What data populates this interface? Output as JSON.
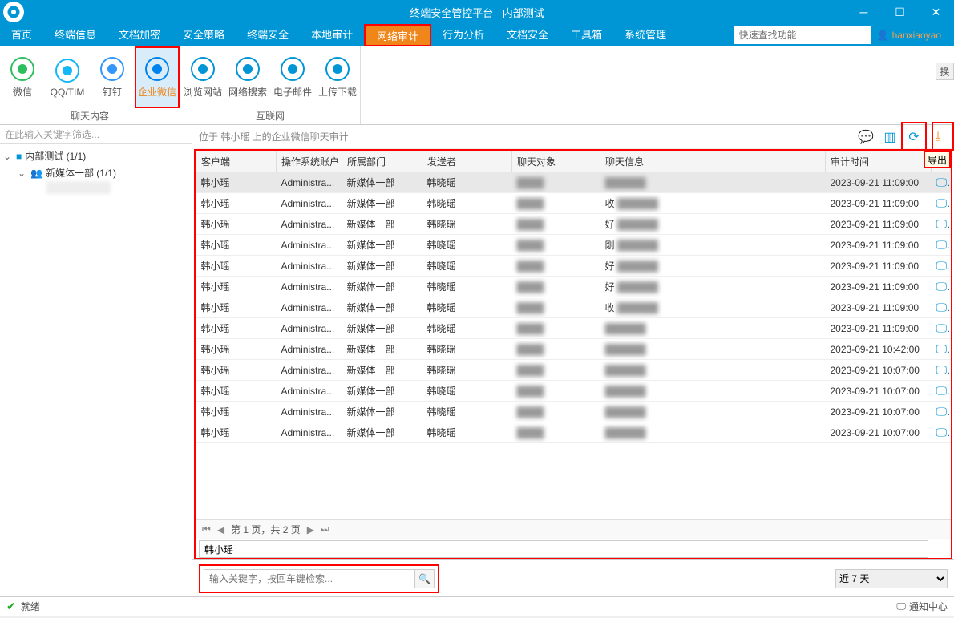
{
  "window": {
    "title": "终端安全管控平台 - 内部测试"
  },
  "menu": {
    "tabs": [
      "首页",
      "终端信息",
      "文档加密",
      "安全策略",
      "终端安全",
      "本地审计",
      "网络审计",
      "行为分析",
      "文档安全",
      "工具箱",
      "系统管理"
    ],
    "active": 6,
    "search_placeholder": "快速查找功能",
    "user": "hanxiaoyao"
  },
  "ribbon": {
    "group1_label": "聊天内容",
    "group2_label": "互联网",
    "buttons1": [
      {
        "label": "微信",
        "name": "wechat-icon"
      },
      {
        "label": "QQ/TIM",
        "name": "qq-icon"
      },
      {
        "label": "钉钉",
        "name": "dingtalk-icon"
      },
      {
        "label": "企业微信",
        "name": "wecom-icon",
        "active": true
      }
    ],
    "buttons2": [
      {
        "label": "浏览网站",
        "name": "browse-icon"
      },
      {
        "label": "网络搜索",
        "name": "search-icon"
      },
      {
        "label": "电子邮件",
        "name": "email-icon"
      },
      {
        "label": "上传下载",
        "name": "updown-icon"
      }
    ]
  },
  "sidebar": {
    "filter_placeholder": "在此输入关键字筛选...",
    "root": "内部测试 (1/1)",
    "child": "新媒体一部 (1/1)"
  },
  "main": {
    "breadcrumb": "位于 韩小瑶 上的企业微信聊天审计",
    "export_tooltip": "导出",
    "columns": [
      "客户端",
      "操作系统账户",
      "所属部门",
      "发送者",
      "聊天对象",
      "聊天信息",
      "审计时间",
      ""
    ],
    "rows": [
      {
        "c": "韩小瑶",
        "o": "Administra...",
        "d": "新媒体一部",
        "s": "韩晓瑶",
        "t": "",
        "m": "",
        "ts": "2023-09-21 11:09:00"
      },
      {
        "c": "韩小瑶",
        "o": "Administra...",
        "d": "新媒体一部",
        "s": "韩晓瑶",
        "t": "",
        "m": "收",
        "ts": "2023-09-21 11:09:00"
      },
      {
        "c": "韩小瑶",
        "o": "Administra...",
        "d": "新媒体一部",
        "s": "韩晓瑶",
        "t": "",
        "m": "好",
        "ts": "2023-09-21 11:09:00"
      },
      {
        "c": "韩小瑶",
        "o": "Administra...",
        "d": "新媒体一部",
        "s": "韩晓瑶",
        "t": "",
        "m": "刚",
        "ts": "2023-09-21 11:09:00"
      },
      {
        "c": "韩小瑶",
        "o": "Administra...",
        "d": "新媒体一部",
        "s": "韩晓瑶",
        "t": "",
        "m": "好",
        "ts": "2023-09-21 11:09:00"
      },
      {
        "c": "韩小瑶",
        "o": "Administra...",
        "d": "新媒体一部",
        "s": "韩晓瑶",
        "t": "",
        "m": "好",
        "ts": "2023-09-21 11:09:00"
      },
      {
        "c": "韩小瑶",
        "o": "Administra...",
        "d": "新媒体一部",
        "s": "韩晓瑶",
        "t": "",
        "m": "收",
        "ts": "2023-09-21 11:09:00"
      },
      {
        "c": "韩小瑶",
        "o": "Administra...",
        "d": "新媒体一部",
        "s": "韩晓瑶",
        "t": "",
        "m": "",
        "ts": "2023-09-21 11:09:00"
      },
      {
        "c": "韩小瑶",
        "o": "Administra...",
        "d": "新媒体一部",
        "s": "韩晓瑶",
        "t": "",
        "m": "",
        "ts": "2023-09-21 10:42:00"
      },
      {
        "c": "韩小瑶",
        "o": "Administra...",
        "d": "新媒体一部",
        "s": "韩晓瑶",
        "t": "",
        "m": "",
        "ts": "2023-09-21 10:07:00"
      },
      {
        "c": "韩小瑶",
        "o": "Administra...",
        "d": "新媒体一部",
        "s": "韩晓瑶",
        "t": "",
        "m": "",
        "ts": "2023-09-21 10:07:00"
      },
      {
        "c": "韩小瑶",
        "o": "Administra...",
        "d": "新媒体一部",
        "s": "韩晓瑶",
        "t": "",
        "m": "",
        "ts": "2023-09-21 10:07:00"
      },
      {
        "c": "韩小瑶",
        "o": "Administra...",
        "d": "新媒体一部",
        "s": "韩晓瑶",
        "t": "",
        "m": "",
        "ts": "2023-09-21 10:07:00"
      }
    ],
    "pager": "第 1 页，共 2 页",
    "detail_name": "韩小瑶",
    "search_placeholder": "输入关键字，按回车键检索...",
    "range": "近 7 天"
  },
  "status": {
    "text": "就绪",
    "notif": "通知中心"
  },
  "side_label": "换"
}
